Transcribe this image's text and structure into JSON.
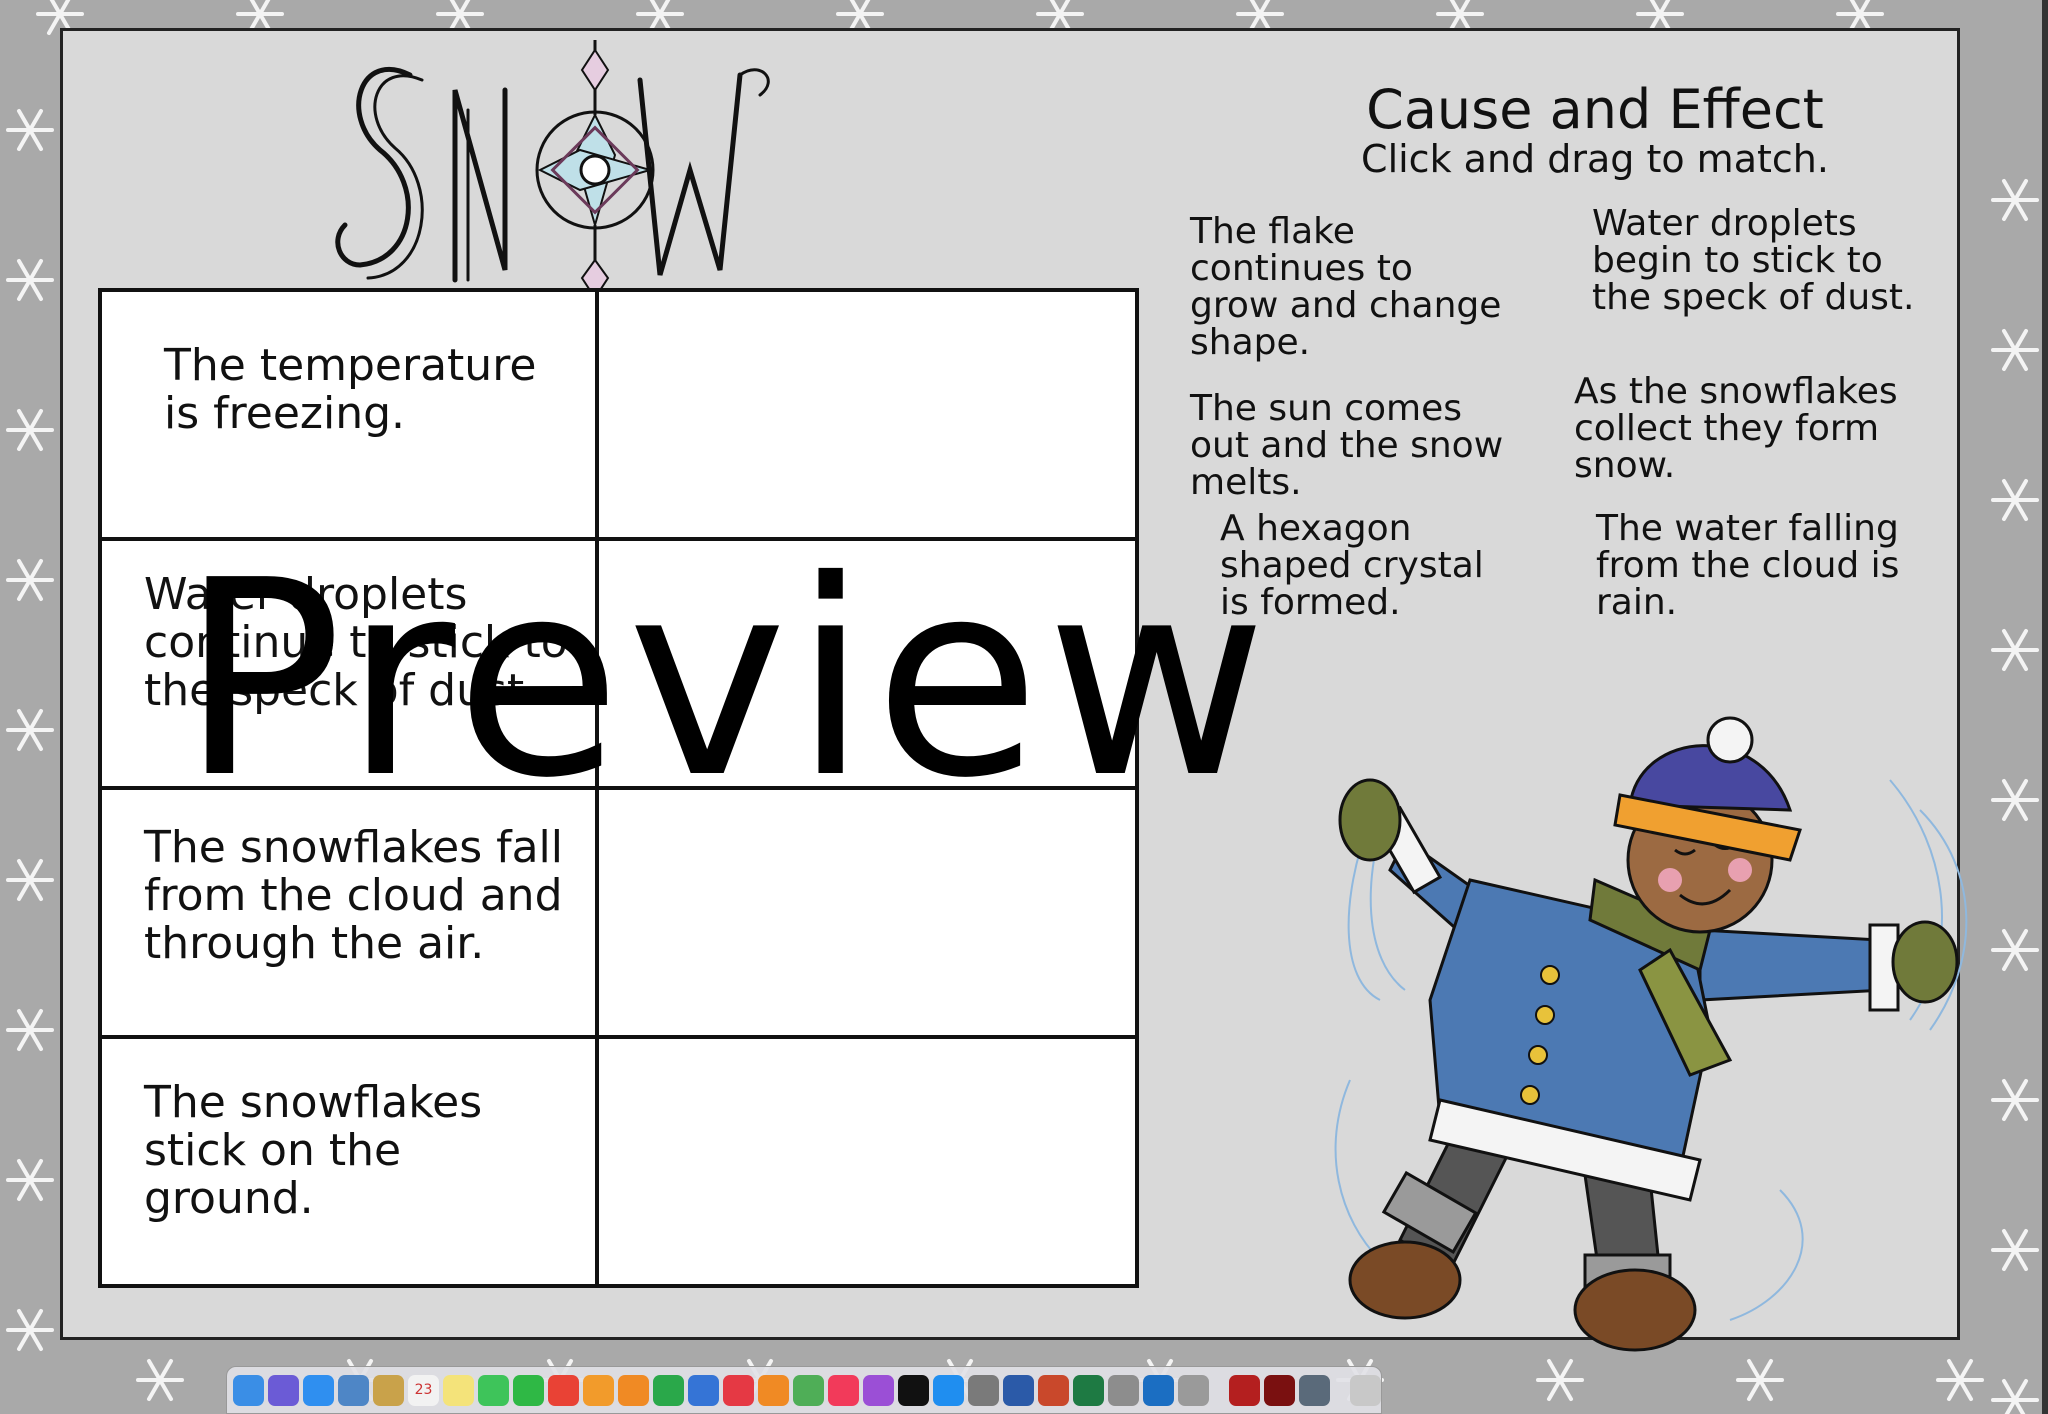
{
  "header": {
    "title": "Cause and Effect",
    "subtitle": "Click and drag to match."
  },
  "logo": {
    "text": "SNOW",
    "icon": "snowflake-icon"
  },
  "cause_rows": [
    {
      "cause": "The temperature is freezing.",
      "effect": ""
    },
    {
      "cause": "Water droplets continue to stick to the speck of dust.",
      "effect": ""
    },
    {
      "cause": "The snowflakes fall from the cloud and through the air.",
      "effect": ""
    },
    {
      "cause": "The snowflakes stick on the ground.",
      "effect": ""
    }
  ],
  "effect_cards": [
    "The flake continues to grow and change shape.",
    "Water droplets begin to stick to the speck of dust.",
    "The sun comes out and the snow melts.",
    "As the snowflakes collect they form snow.",
    "A hexagon shaped crystal is formed.",
    "The water falling from the cloud is rain."
  ],
  "watermark": "Preview",
  "illustration": "child-making-snow-angel",
  "dock": {
    "icons": [
      "finder-icon",
      "siri-icon",
      "safari-icon",
      "preview-icon",
      "notes-icon",
      "calendar-icon",
      "stickies-icon",
      "messages-icon",
      "facetime-icon",
      "chrome-icon",
      "photos-icon",
      "pages-icon",
      "numbers-icon",
      "keynote-icon",
      "news-icon",
      "books-icon",
      "maps-icon",
      "music-icon",
      "podcasts-icon",
      "appletv-icon",
      "appstore-icon",
      "systemprefs-icon",
      "word-icon",
      "powerpoint-icon",
      "excel-icon",
      "launchpad-icon",
      "outlook-icon",
      "directory-icon",
      "acrobat-icon",
      "acrobat-dc-icon",
      "image-capture-icon",
      "trash-icon"
    ],
    "colors": [
      "#3a8ee6",
      "#6b5bd6",
      "#2f8ff0",
      "#4e86c6",
      "#c9a24a",
      "#f2f2f2",
      "#f4e37a",
      "#3ec45a",
      "#2fb845",
      "#e94235",
      "#f29b2b",
      "#f08a24",
      "#2aa84a",
      "#3574d6",
      "#e53944",
      "#f08a24",
      "#4fae57",
      "#f23a5a",
      "#9b4fd6",
      "#111111",
      "#1f8ef0",
      "#7a7a7a",
      "#2b5aa8",
      "#c9482b",
      "#1e7a43",
      "#8d8d8d",
      "#1b6ec2",
      "#9a9a9a",
      "#b41f1f",
      "#7a1010",
      "#5a6a7a",
      "#c8c8c8"
    ],
    "calendar_day": "23"
  }
}
